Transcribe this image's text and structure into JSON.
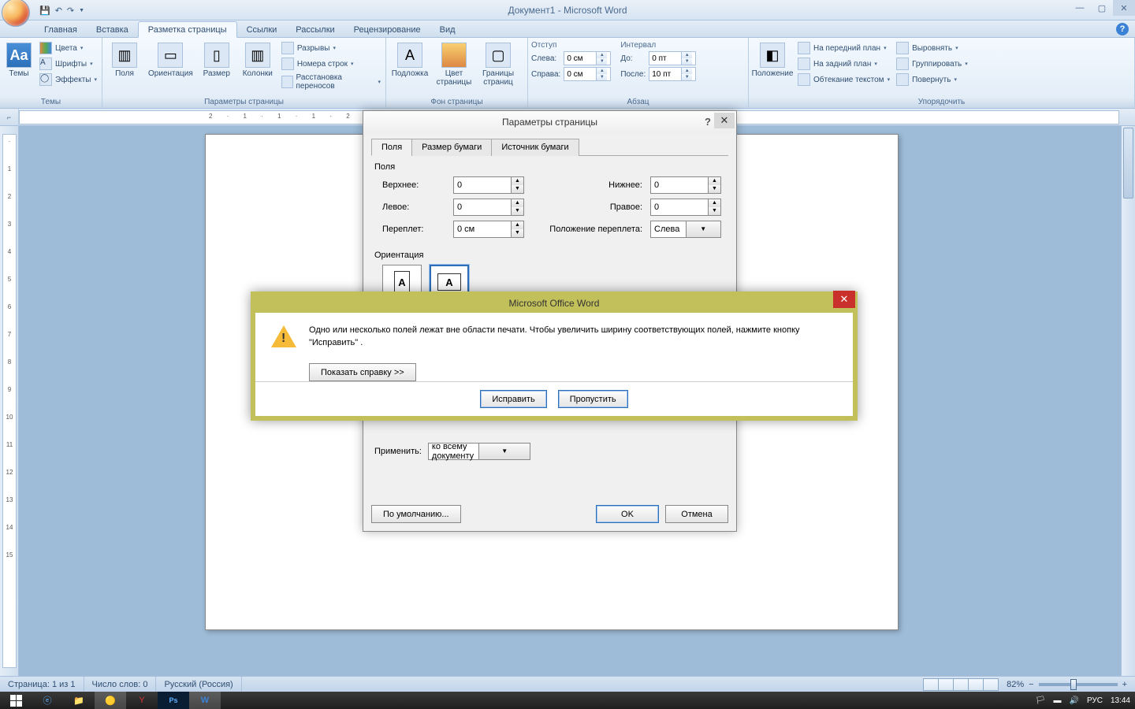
{
  "window": {
    "title": "Документ1 - Microsoft Word"
  },
  "tabs": {
    "home": "Главная",
    "insert": "Вставка",
    "layout": "Разметка страницы",
    "refs": "Ссылки",
    "mail": "Рассылки",
    "review": "Рецензирование",
    "view": "Вид"
  },
  "ribbon": {
    "themes": {
      "label": "Темы",
      "main": "Темы",
      "colors": "Цвета",
      "fonts": "Шрифты",
      "effects": "Эффекты"
    },
    "page_setup": {
      "label": "Параметры страницы",
      "margins": "Поля",
      "orientation": "Ориентация",
      "size": "Размер",
      "columns": "Колонки",
      "breaks": "Разрывы",
      "line_numbers": "Номера строк",
      "hyphenation": "Расстановка переносов"
    },
    "background": {
      "label": "Фон страницы",
      "watermark": "Подложка",
      "color": "Цвет\nстраницы",
      "borders": "Границы\nстраниц"
    },
    "paragraph": {
      "label": "Абзац",
      "indent": "Отступ",
      "spacing": "Интервал",
      "left": "Слева:",
      "right": "Справа:",
      "before": "До:",
      "after": "После:",
      "left_val": "0 см",
      "right_val": "0 см",
      "before_val": "0 пт",
      "after_val": "10 пт"
    },
    "arrange": {
      "label": "Упорядочить",
      "position": "Положение",
      "front": "На передний план",
      "back": "На задний план",
      "wrap": "Обтекание текстом",
      "align": "Выровнять",
      "group": "Группировать",
      "rotate": "Повернуть"
    }
  },
  "dialog": {
    "title": "Параметры страницы",
    "tabs": {
      "margins": "Поля",
      "paper": "Размер бумаги",
      "source": "Источник бумаги"
    },
    "margins_section": "Поля",
    "orientation_section": "Ориентация",
    "top": "Верхнее:",
    "bottom": "Нижнее:",
    "left": "Левое:",
    "right": "Правое:",
    "gutter": "Переплет:",
    "gutter_pos": "Положение переплета:",
    "top_val": "0",
    "bottom_val": "0",
    "left_val": "0",
    "right_val": "0",
    "gutter_val": "0 см",
    "gutter_pos_val": "Слева",
    "apply_to": "Применить:",
    "apply_to_val": "ко всему документу",
    "default": "По умолчанию...",
    "ok": "OK",
    "cancel": "Отмена"
  },
  "alert": {
    "title": "Microsoft Office Word",
    "text": "Одно или несколько полей лежат вне области печати. Чтобы увеличить ширину соответствующих полей, нажмите кнопку \"Исправить\" .",
    "help": "Показать справку >>",
    "fix": "Исправить",
    "skip": "Пропустить"
  },
  "status": {
    "page": "Страница: 1 из 1",
    "words": "Число слов: 0",
    "lang": "Русский (Россия)",
    "zoom": "82%"
  },
  "tray": {
    "lang": "РУС",
    "time": "13:44"
  }
}
